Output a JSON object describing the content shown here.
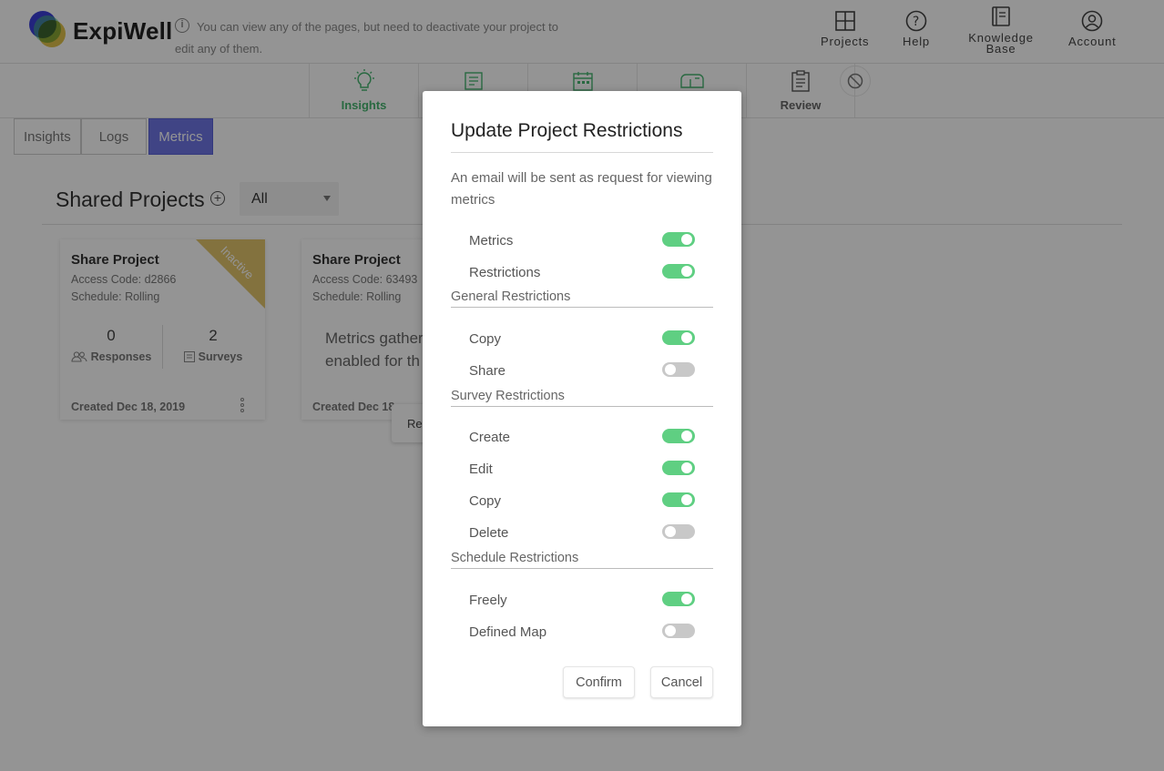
{
  "header": {
    "brand": "ExpiWell",
    "notice": "You can view any of the pages, but need to deactivate your project to edit any of them.",
    "nav": [
      {
        "label": "Projects",
        "icon": "projects-grid-icon"
      },
      {
        "label": "Help",
        "icon": "help-icon"
      },
      {
        "label": "Knowledge Base",
        "icon": "book-icon"
      },
      {
        "label": "Account",
        "icon": "account-icon"
      }
    ]
  },
  "subnav": {
    "items": [
      {
        "label": "Insights",
        "icon": "lightbulb-icon",
        "active": true
      },
      {
        "label": "",
        "icon": "document-icon"
      },
      {
        "label": "",
        "icon": "calendar-icon"
      },
      {
        "label": "",
        "icon": "mailbox-icon"
      },
      {
        "label": "Review",
        "icon": "clipboard-icon"
      }
    ]
  },
  "tabs": [
    "Insights",
    "Logs",
    "Metrics"
  ],
  "shared": {
    "title": "Shared Projects",
    "filter_value": "All"
  },
  "cards": [
    {
      "title": "Share Project",
      "access": "Access Code: d2866",
      "schedule": "Schedule: Rolling",
      "responses_count": "0",
      "responses_label": "Responses",
      "surveys_count": "2",
      "surveys_label": "Surveys",
      "created": "Created Dec 18, 2019",
      "badge": "Inactive"
    },
    {
      "title": "Share Project",
      "access": "Access Code: 63493",
      "schedule": "Schedule: Rolling",
      "message_line1": "Metrics gather",
      "message_line2": "enabled for th",
      "created": "Created Dec 18"
    }
  ],
  "popup_menu": "Res",
  "modal": {
    "title": "Update Project Restrictions",
    "description": "An email will be sent as request for viewing metrics",
    "top_toggles": [
      {
        "label": "Metrics",
        "on": true
      },
      {
        "label": "Restrictions",
        "on": true
      }
    ],
    "general": {
      "title": "General Restrictions",
      "toggles": [
        {
          "label": "Copy",
          "on": true
        },
        {
          "label": "Share",
          "on": false
        }
      ]
    },
    "survey": {
      "title": "Survey Restrictions",
      "toggles": [
        {
          "label": "Create",
          "on": true
        },
        {
          "label": "Edit",
          "on": true
        },
        {
          "label": "Copy",
          "on": true
        },
        {
          "label": "Delete",
          "on": false
        }
      ]
    },
    "schedule": {
      "title": "Schedule Restrictions",
      "toggles": [
        {
          "label": "Freely",
          "on": true
        },
        {
          "label": "Defined Map",
          "on": false
        }
      ]
    },
    "confirm_label": "Confirm",
    "cancel_label": "Cancel"
  },
  "colors": {
    "accent_green": "#47b670",
    "toggle_on": "#5fcf82",
    "tab_active": "#6f76e6",
    "inactive_badge": "#e2c46b"
  }
}
